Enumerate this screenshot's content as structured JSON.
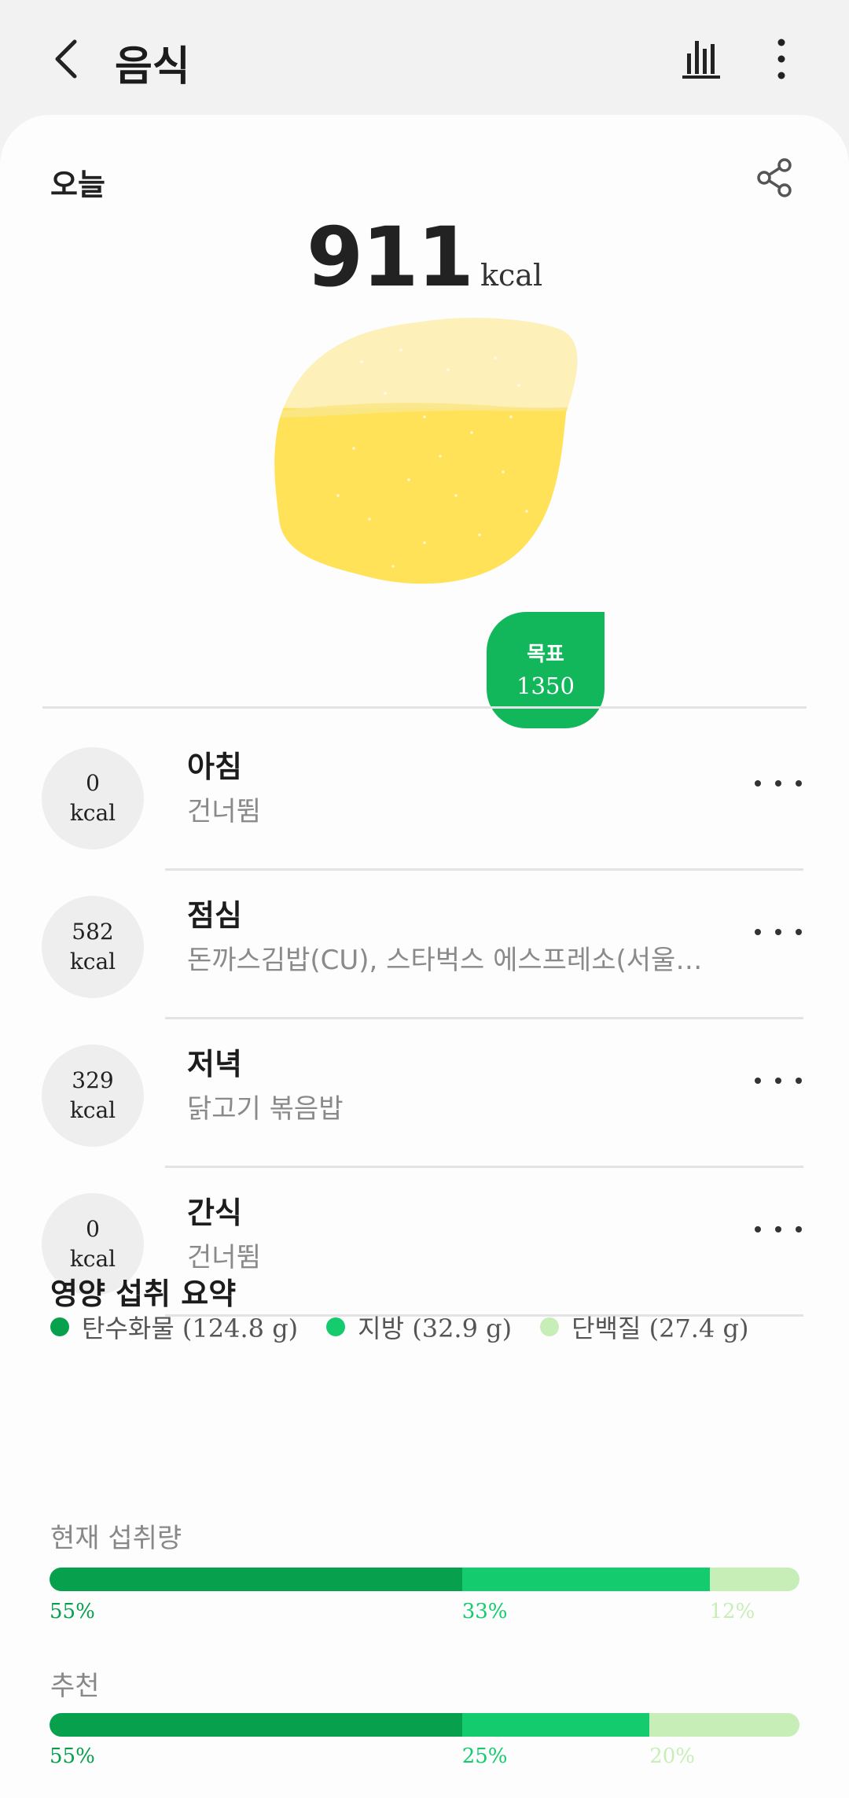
{
  "header": {
    "title": "음식"
  },
  "summary": {
    "today_label": "오늘",
    "calories": "911",
    "calories_unit": "kcal",
    "goal_label": "목표",
    "goal_value": "1350",
    "progress_fraction": 0.675
  },
  "meals": [
    {
      "kcal": "0",
      "unit": "kcal",
      "name": "아침",
      "desc": "건너뜀"
    },
    {
      "kcal": "582",
      "unit": "kcal",
      "name": "점심",
      "desc": "돈까스김밥(CU), 스타벅스 에스프레소(서울…"
    },
    {
      "kcal": "329",
      "unit": "kcal",
      "name": "저녁",
      "desc": "닭고기 볶음밥"
    },
    {
      "kcal": "0",
      "unit": "kcal",
      "name": "간식",
      "desc": "건너뜀"
    }
  ],
  "nutrition": {
    "title": "영양 섭취 요약",
    "legend": [
      {
        "label": "탄수화물 (124.8 g)",
        "color": "#07a14e"
      },
      {
        "label": "지방 (32.9 g)",
        "color": "#14cc6e"
      },
      {
        "label": "단백질 (27.4 g)",
        "color": "#c8eeb8"
      }
    ],
    "current": {
      "label": "현재 섭취량",
      "values": [
        55,
        33,
        12
      ],
      "labels": [
        "55%",
        "33%",
        "12%"
      ]
    },
    "recommended": {
      "label": "추천",
      "values": [
        55,
        25,
        20
      ],
      "labels": [
        "55%",
        "25%",
        "20%"
      ]
    }
  },
  "colors": {
    "carb": "#07a14e",
    "fat": "#14cc6e",
    "protein": "#c8eeb8",
    "goal": "#12b75b",
    "blob_full": "#ffe257",
    "blob_empty": "#fdf0b8"
  }
}
